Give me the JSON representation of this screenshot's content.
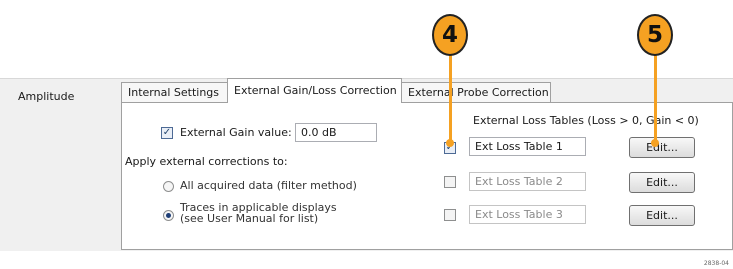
{
  "section_label": "Amplitude",
  "tabs": [
    {
      "label": "Internal Settings",
      "active": false
    },
    {
      "label": "External Gain/Loss Correction",
      "active": true
    },
    {
      "label": "External Probe Correction",
      "active": false
    }
  ],
  "gain": {
    "checkbox_label": "External Gain value:",
    "checked": true,
    "value": "0.0 dB"
  },
  "apply_heading": "Apply external corrections to:",
  "apply_options": [
    {
      "label": "All acquired data (filter method)",
      "selected": false
    },
    {
      "label_line1": "Traces in applicable displays",
      "label_line2": "(see User Manual for list)",
      "selected": true
    }
  ],
  "loss_tables_heading": "External Loss Tables (Loss > 0, Gain < 0)",
  "loss_tables": [
    {
      "name": "Ext Loss Table 1",
      "checked": true,
      "button": "Edit..."
    },
    {
      "name": "Ext Loss Table 2",
      "checked": false,
      "button": "Edit..."
    },
    {
      "name": "Ext Loss Table 3",
      "checked": false,
      "button": "Edit..."
    }
  ],
  "callouts": [
    "4",
    "5"
  ],
  "figure_number": "2838-04",
  "colors": {
    "callout": "#f5a122",
    "accent": "#1f3f77"
  }
}
